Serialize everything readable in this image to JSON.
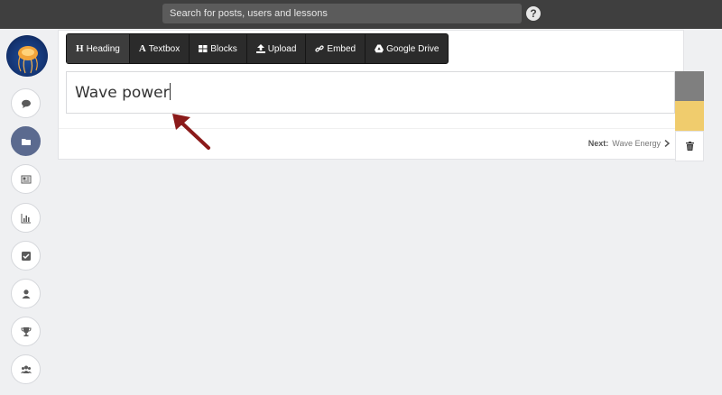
{
  "search": {
    "placeholder": "Search for posts, users and lessons"
  },
  "help": {
    "label": "?"
  },
  "toolbar": {
    "items": [
      {
        "label": "Heading",
        "icon": "heading-icon"
      },
      {
        "label": "Textbox",
        "icon": "textbox-icon"
      },
      {
        "label": "Blocks",
        "icon": "blocks-icon"
      },
      {
        "label": "Upload",
        "icon": "upload-icon"
      },
      {
        "label": "Embed",
        "icon": "embed-icon"
      },
      {
        "label": "Google Drive",
        "icon": "google-drive-icon"
      }
    ]
  },
  "editor": {
    "heading_value": "Wave power"
  },
  "footer": {
    "next_label": "Next:",
    "next_title": "Wave Energy"
  },
  "sidebar": {
    "items": [
      {
        "icon": "chat-icon"
      },
      {
        "icon": "folder-icon",
        "active": true
      },
      {
        "icon": "newspaper-icon"
      },
      {
        "icon": "bar-chart-icon"
      },
      {
        "icon": "checkbox-icon"
      },
      {
        "icon": "user-icon"
      },
      {
        "icon": "trophy-icon"
      },
      {
        "icon": "group-icon"
      }
    ]
  },
  "colors": {
    "topbar": "#3f3f3f",
    "swatch_grey": "#7f7f7f",
    "swatch_yellow": "#f0cc6d",
    "arrow": "#8b1a1a",
    "sidebar_active": "#5b6a8f"
  }
}
